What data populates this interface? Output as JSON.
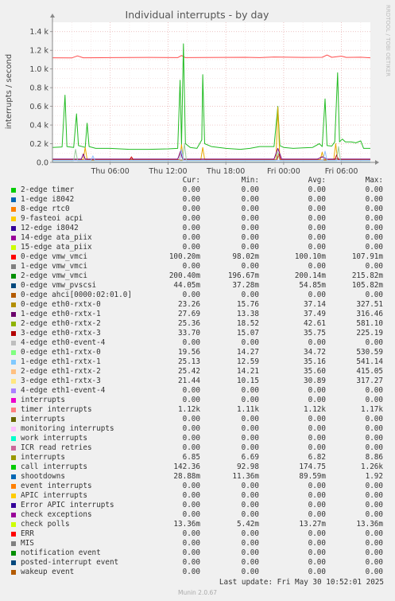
{
  "chart_data": {
    "type": "line",
    "title": "Individual interrupts - by day",
    "ylabel": "interrupts / second",
    "side_label": "RRDTOOL / TOBI OETIKER",
    "ylim": [
      0,
      1500
    ],
    "yticks": [
      {
        "v": 0,
        "label": "0.0"
      },
      {
        "v": 200,
        "label": "0.2 k"
      },
      {
        "v": 400,
        "label": "0.4 k"
      },
      {
        "v": 600,
        "label": "0.6 k"
      },
      {
        "v": 800,
        "label": "0.8 k"
      },
      {
        "v": 1000,
        "label": "1.0 k"
      },
      {
        "v": 1200,
        "label": "1.2 k"
      },
      {
        "v": 1400,
        "label": "1.4 k"
      }
    ],
    "xlim": [
      0,
      33
    ],
    "xticks": [
      {
        "v": 6,
        "label": "Thu 06:00"
      },
      {
        "v": 12,
        "label": "Thu 12:00"
      },
      {
        "v": 18,
        "label": "Thu 18:00"
      },
      {
        "v": 24,
        "label": "Fri 00:00"
      },
      {
        "v": 30,
        "label": "Fri 06:00"
      }
    ],
    "series": [
      {
        "name": "timer interrupts",
        "color": "#ff4d4d",
        "values": [
          [
            0,
            1120
          ],
          [
            2,
            1118
          ],
          [
            2.6,
            1140
          ],
          [
            3.2,
            1120
          ],
          [
            6,
            1122
          ],
          [
            10,
            1124
          ],
          [
            13,
            1122
          ],
          [
            13.4,
            1145
          ],
          [
            13.8,
            1122
          ],
          [
            20,
            1125
          ],
          [
            21.5,
            1122
          ],
          [
            23,
            1128
          ],
          [
            26,
            1124
          ],
          [
            28,
            1125
          ],
          [
            28.5,
            1150
          ],
          [
            29,
            1125
          ],
          [
            30,
            1138
          ],
          [
            30.5,
            1124
          ],
          [
            32,
            1126
          ],
          [
            33,
            1120
          ]
        ]
      },
      {
        "name": "call interrupts",
        "color": "#22bb22",
        "values": [
          [
            0,
            160
          ],
          [
            1,
            165
          ],
          [
            1.3,
            720
          ],
          [
            1.5,
            170
          ],
          [
            2.2,
            160
          ],
          [
            2.5,
            520
          ],
          [
            2.7,
            180
          ],
          [
            3.4,
            160
          ],
          [
            3.6,
            420
          ],
          [
            3.8,
            170
          ],
          [
            4.5,
            150
          ],
          [
            6,
            150
          ],
          [
            8,
            140
          ],
          [
            10,
            140
          ],
          [
            12,
            145
          ],
          [
            13,
            150
          ],
          [
            13.25,
            880
          ],
          [
            13.4,
            180
          ],
          [
            13.6,
            1270
          ],
          [
            13.8,
            200
          ],
          [
            14.3,
            160
          ],
          [
            15,
            150
          ],
          [
            15.5,
            240
          ],
          [
            15.6,
            940
          ],
          [
            15.8,
            200
          ],
          [
            16.5,
            170
          ],
          [
            18,
            150
          ],
          [
            19.5,
            140
          ],
          [
            20.5,
            150
          ],
          [
            21.5,
            170
          ],
          [
            23,
            170
          ],
          [
            23.4,
            600
          ],
          [
            23.6,
            180
          ],
          [
            24,
            160
          ],
          [
            25,
            150
          ],
          [
            26,
            155
          ],
          [
            27,
            160
          ],
          [
            27.7,
            200
          ],
          [
            28,
            170
          ],
          [
            28.3,
            680
          ],
          [
            28.5,
            180
          ],
          [
            29,
            175
          ],
          [
            29.3,
            220
          ],
          [
            29.6,
            960
          ],
          [
            29.8,
            220
          ],
          [
            30.1,
            250
          ],
          [
            30.4,
            220
          ],
          [
            31,
            220
          ],
          [
            31.5,
            210
          ],
          [
            32,
            230
          ],
          [
            32.3,
            150
          ],
          [
            33,
            150
          ]
        ]
      },
      {
        "name": "0-edge eth0-rxtx-0",
        "color": "#e6a800",
        "values": [
          [
            0,
            30
          ],
          [
            3.2,
            30
          ],
          [
            3.4,
            160
          ],
          [
            3.6,
            30
          ],
          [
            11,
            30
          ],
          [
            13.2,
            30
          ],
          [
            13.4,
            190
          ],
          [
            13.6,
            30
          ],
          [
            15.4,
            30
          ],
          [
            15.6,
            160
          ],
          [
            15.8,
            30
          ],
          [
            23.2,
            30
          ],
          [
            23.4,
            590
          ],
          [
            23.6,
            30
          ],
          [
            27.8,
            30
          ],
          [
            28.0,
            110
          ],
          [
            28.2,
            30
          ],
          [
            29.2,
            30
          ],
          [
            29.4,
            200
          ],
          [
            29.6,
            30
          ],
          [
            33,
            30
          ]
        ]
      },
      {
        "name": "1-edge eth0-rxtx-1",
        "color": "#7a007a",
        "values": [
          [
            0,
            35
          ],
          [
            3,
            35
          ],
          [
            3.2,
            90
          ],
          [
            3.4,
            35
          ],
          [
            13.0,
            35
          ],
          [
            13.3,
            120
          ],
          [
            13.5,
            35
          ],
          [
            23.0,
            35
          ],
          [
            23.4,
            150
          ],
          [
            23.8,
            35
          ],
          [
            27.5,
            35
          ],
          [
            28.0,
            60
          ],
          [
            28.5,
            35
          ],
          [
            33,
            35
          ]
        ]
      },
      {
        "name": "3-edge eth0-rxtx-3",
        "color": "#cc0000",
        "values": [
          [
            0,
            25
          ],
          [
            8,
            25
          ],
          [
            8.2,
            60
          ],
          [
            8.4,
            25
          ],
          [
            16,
            25
          ],
          [
            23.3,
            25
          ],
          [
            23.5,
            90
          ],
          [
            23.7,
            25
          ],
          [
            29.3,
            25
          ],
          [
            29.5,
            80
          ],
          [
            29.7,
            25
          ],
          [
            33,
            25
          ]
        ]
      },
      {
        "name": "0-edge eth1-rxtx-0",
        "color": "#99cc99",
        "values": [
          [
            0,
            20
          ],
          [
            2.2,
            20
          ],
          [
            2.4,
            140
          ],
          [
            2.6,
            20
          ],
          [
            13.5,
            20
          ],
          [
            13.7,
            200
          ],
          [
            13.9,
            20
          ],
          [
            23.2,
            20
          ],
          [
            23.4,
            110
          ],
          [
            23.6,
            20
          ],
          [
            29.5,
            20
          ],
          [
            29.7,
            170
          ],
          [
            29.9,
            20
          ],
          [
            33,
            20
          ]
        ]
      },
      {
        "name": "1-edge eth1-rxtx-1",
        "color": "#8fbfff",
        "values": [
          [
            0,
            22
          ],
          [
            4,
            22
          ],
          [
            4.2,
            70
          ],
          [
            4.4,
            22
          ],
          [
            13.2,
            22
          ],
          [
            13.4,
            140
          ],
          [
            13.6,
            22
          ],
          [
            20,
            22
          ],
          [
            28.1,
            22
          ],
          [
            28.3,
            120
          ],
          [
            28.5,
            22
          ],
          [
            33,
            22
          ]
        ]
      },
      {
        "name": "shootdowns",
        "color": "#0066b3",
        "values": [
          [
            0,
            2
          ],
          [
            33,
            2
          ]
        ]
      }
    ]
  },
  "legend": {
    "headers": [
      "Cur:",
      "Min:",
      "Avg:",
      "Max:"
    ],
    "rows": [
      {
        "color": "#00cc00",
        "name": "2-edge timer",
        "cur": "0.00",
        "min": "0.00",
        "avg": "0.00",
        "max": "0.00"
      },
      {
        "color": "#0066b3",
        "name": "1-edge i8042",
        "cur": "0.00",
        "min": "0.00",
        "avg": "0.00",
        "max": "0.00"
      },
      {
        "color": "#ff8000",
        "name": "8-edge rtc0",
        "cur": "0.00",
        "min": "0.00",
        "avg": "0.00",
        "max": "0.00"
      },
      {
        "color": "#ffcc00",
        "name": "9-fasteoi acpi",
        "cur": "0.00",
        "min": "0.00",
        "avg": "0.00",
        "max": "0.00"
      },
      {
        "color": "#330099",
        "name": "12-edge i8042",
        "cur": "0.00",
        "min": "0.00",
        "avg": "0.00",
        "max": "0.00"
      },
      {
        "color": "#990099",
        "name": "14-edge ata_piix",
        "cur": "0.00",
        "min": "0.00",
        "avg": "0.00",
        "max": "0.00"
      },
      {
        "color": "#ccff00",
        "name": "15-edge ata_piix",
        "cur": "0.00",
        "min": "0.00",
        "avg": "0.00",
        "max": "0.00"
      },
      {
        "color": "#ff0000",
        "name": "0-edge vmw_vmci",
        "cur": "100.20m",
        "min": "98.02m",
        "avg": "100.10m",
        "max": "107.91m"
      },
      {
        "color": "#808080",
        "name": "1-edge vmw_vmci",
        "cur": "0.00",
        "min": "0.00",
        "avg": "0.00",
        "max": "0.00"
      },
      {
        "color": "#008f00",
        "name": "2-edge vmw_vmci",
        "cur": "200.40m",
        "min": "196.67m",
        "avg": "200.14m",
        "max": "215.82m"
      },
      {
        "color": "#00487d",
        "name": "0-edge vmw_pvscsi",
        "cur": "44.05m",
        "min": "37.28m",
        "avg": "54.85m",
        "max": "105.82m"
      },
      {
        "color": "#b35a00",
        "name": "0-edge ahci[0000:02:01.0]",
        "cur": "0.00",
        "min": "0.00",
        "avg": "0.00",
        "max": "0.00"
      },
      {
        "color": "#b38f00",
        "name": "0-edge eth0-rxtx-0",
        "cur": "23.26",
        "min": "15.76",
        "avg": "37.14",
        "max": "327.51"
      },
      {
        "color": "#6b006b",
        "name": "1-edge eth0-rxtx-1",
        "cur": "27.69",
        "min": "13.38",
        "avg": "37.49",
        "max": "316.46"
      },
      {
        "color": "#8fb300",
        "name": "2-edge eth0-rxtx-2",
        "cur": "25.36",
        "min": "18.52",
        "avg": "42.61",
        "max": "581.10"
      },
      {
        "color": "#b30000",
        "name": "3-edge eth0-rxtx-3",
        "cur": "33.70",
        "min": "15.07",
        "avg": "35.75",
        "max": "225.19"
      },
      {
        "color": "#bebebe",
        "name": "4-edge eth0-event-4",
        "cur": "0.00",
        "min": "0.00",
        "avg": "0.00",
        "max": "0.00"
      },
      {
        "color": "#80ff80",
        "name": "0-edge eth1-rxtx-0",
        "cur": "19.56",
        "min": "14.27",
        "avg": "34.72",
        "max": "530.59"
      },
      {
        "color": "#80c9ff",
        "name": "1-edge eth1-rxtx-1",
        "cur": "25.13",
        "min": "12.59",
        "avg": "35.16",
        "max": "541.14"
      },
      {
        "color": "#ffc080",
        "name": "2-edge eth1-rxtx-2",
        "cur": "25.42",
        "min": "14.21",
        "avg": "35.60",
        "max": "415.05"
      },
      {
        "color": "#ffe680",
        "name": "3-edge eth1-rxtx-3",
        "cur": "21.44",
        "min": "10.15",
        "avg": "30.89",
        "max": "317.27"
      },
      {
        "color": "#aa80ff",
        "name": "4-edge eth1-event-4",
        "cur": "0.00",
        "min": "0.00",
        "avg": "0.00",
        "max": "0.00"
      },
      {
        "color": "#ee00cc",
        "name": "interrupts",
        "cur": "0.00",
        "min": "0.00",
        "avg": "0.00",
        "max": "0.00"
      },
      {
        "color": "#ff8080",
        "name": "timer interrupts",
        "cur": "1.12k",
        "min": "1.11k",
        "avg": "1.12k",
        "max": "1.17k"
      },
      {
        "color": "#666600",
        "name": "interrupts",
        "cur": "0.00",
        "min": "0.00",
        "avg": "0.00",
        "max": "0.00"
      },
      {
        "color": "#ffbfff",
        "name": "monitoring interrupts",
        "cur": "0.00",
        "min": "0.00",
        "avg": "0.00",
        "max": "0.00"
      },
      {
        "color": "#00ffcc",
        "name": "work interrupts",
        "cur": "0.00",
        "min": "0.00",
        "avg": "0.00",
        "max": "0.00"
      },
      {
        "color": "#cc6699",
        "name": "ICR read retries",
        "cur": "0.00",
        "min": "0.00",
        "avg": "0.00",
        "max": "0.00"
      },
      {
        "color": "#999900",
        "name": "interrupts",
        "cur": "6.85",
        "min": "6.69",
        "avg": "6.82",
        "max": "8.86"
      },
      {
        "color": "#00cc00",
        "name": "call interrupts",
        "cur": "142.36",
        "min": "92.98",
        "avg": "174.75",
        "max": "1.26k"
      },
      {
        "color": "#0066b3",
        "name": "shootdowns",
        "cur": "28.88m",
        "min": "11.36m",
        "avg": "89.59m",
        "max": "1.92"
      },
      {
        "color": "#ff8000",
        "name": "event interrupts",
        "cur": "0.00",
        "min": "0.00",
        "avg": "0.00",
        "max": "0.00"
      },
      {
        "color": "#ffcc00",
        "name": "APIC interrupts",
        "cur": "0.00",
        "min": "0.00",
        "avg": "0.00",
        "max": "0.00"
      },
      {
        "color": "#330099",
        "name": "Error APIC interrupts",
        "cur": "0.00",
        "min": "0.00",
        "avg": "0.00",
        "max": "0.00"
      },
      {
        "color": "#990099",
        "name": "check exceptions",
        "cur": "0.00",
        "min": "0.00",
        "avg": "0.00",
        "max": "0.00"
      },
      {
        "color": "#ccff00",
        "name": "check polls",
        "cur": "13.36m",
        "min": "5.42m",
        "avg": "13.27m",
        "max": "13.36m"
      },
      {
        "color": "#ff0000",
        "name": "ERR",
        "cur": "0.00",
        "min": "0.00",
        "avg": "0.00",
        "max": "0.00"
      },
      {
        "color": "#808080",
        "name": "MIS",
        "cur": "0.00",
        "min": "0.00",
        "avg": "0.00",
        "max": "0.00"
      },
      {
        "color": "#008f00",
        "name": "notification event",
        "cur": "0.00",
        "min": "0.00",
        "avg": "0.00",
        "max": "0.00"
      },
      {
        "color": "#00487d",
        "name": "posted-interrupt event",
        "cur": "0.00",
        "min": "0.00",
        "avg": "0.00",
        "max": "0.00"
      },
      {
        "color": "#b35a00",
        "name": "wakeup event",
        "cur": "0.00",
        "min": "0.00",
        "avg": "0.00",
        "max": "0.00"
      }
    ]
  },
  "footer": {
    "last_update": "Last update: Fri May 30 10:52:01 2025",
    "generator": "Munin 2.0.67"
  }
}
